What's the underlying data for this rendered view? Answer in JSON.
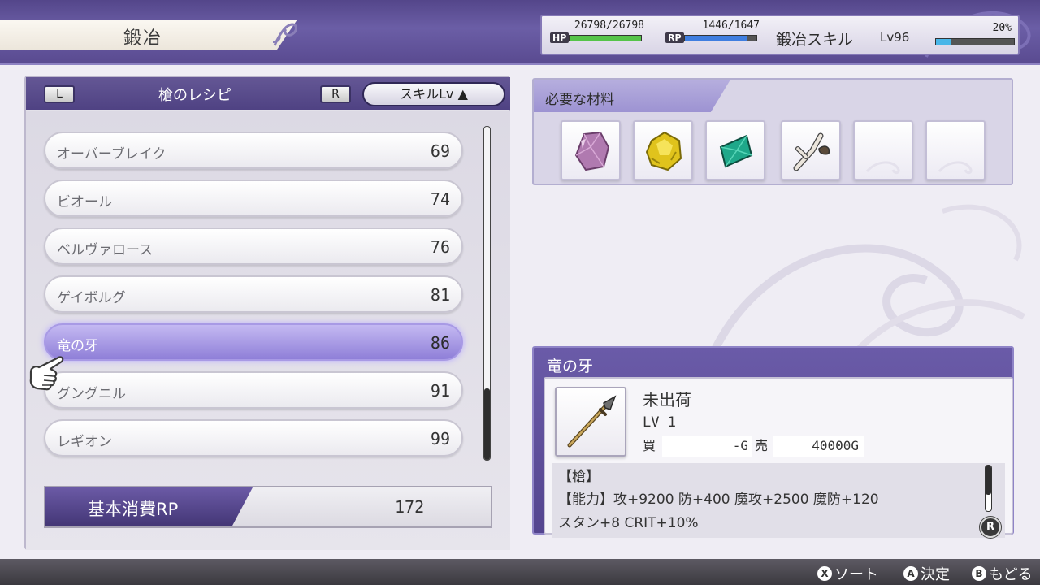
{
  "header": {
    "screen_title": "鍛冶",
    "hp_value": "26798/26798",
    "hp_label": "HP",
    "hp_fraction": 1.0,
    "rp_value": "1446/1647",
    "rp_label": "RP",
    "rp_fraction": 0.878,
    "skill_name": "鍛冶スキル",
    "skill_level": "Lv96",
    "skill_progress": "20%",
    "skill_fraction": 0.2
  },
  "recipes": {
    "title": "槍のレシピ",
    "left_key": "L",
    "right_key": "R",
    "sort_label": "スキルLv ▲",
    "items": [
      {
        "name": "オーバーブレイク",
        "lv": "69"
      },
      {
        "name": "ビオール",
        "lv": "74"
      },
      {
        "name": "ベルヴァロース",
        "lv": "76"
      },
      {
        "name": "ゲイボルグ",
        "lv": "81"
      },
      {
        "name": "竜の牙",
        "lv": "86"
      },
      {
        "name": "グングニル",
        "lv": "91"
      },
      {
        "name": "レギオン",
        "lv": "99"
      }
    ],
    "selected_index": 4,
    "base_rp_label": "基本消費RP",
    "base_rp_value": "172"
  },
  "materials": {
    "title": "必要な材料",
    "slots": [
      "amethyst-icon",
      "gold-ore-icon",
      "emerald-icon",
      "branch-icon",
      "",
      ""
    ]
  },
  "detail": {
    "name": "竜の牙",
    "ship_status": "未出荷",
    "level": "LV 1",
    "buy_label": "買",
    "buy_price": "-G",
    "sell_label": "売",
    "sell_price": "40000G",
    "category": "【槍】",
    "abilities_line": "【能力】攻+9200 防+400 魔攻+2500 魔防+120",
    "extra_line": "スタン+8 CRIT+10%",
    "scroll_key": "R"
  },
  "footer": {
    "sort": {
      "key": "X",
      "label": "ソート"
    },
    "confirm": {
      "key": "A",
      "label": "決定"
    },
    "back": {
      "key": "B",
      "label": "もどる"
    }
  }
}
